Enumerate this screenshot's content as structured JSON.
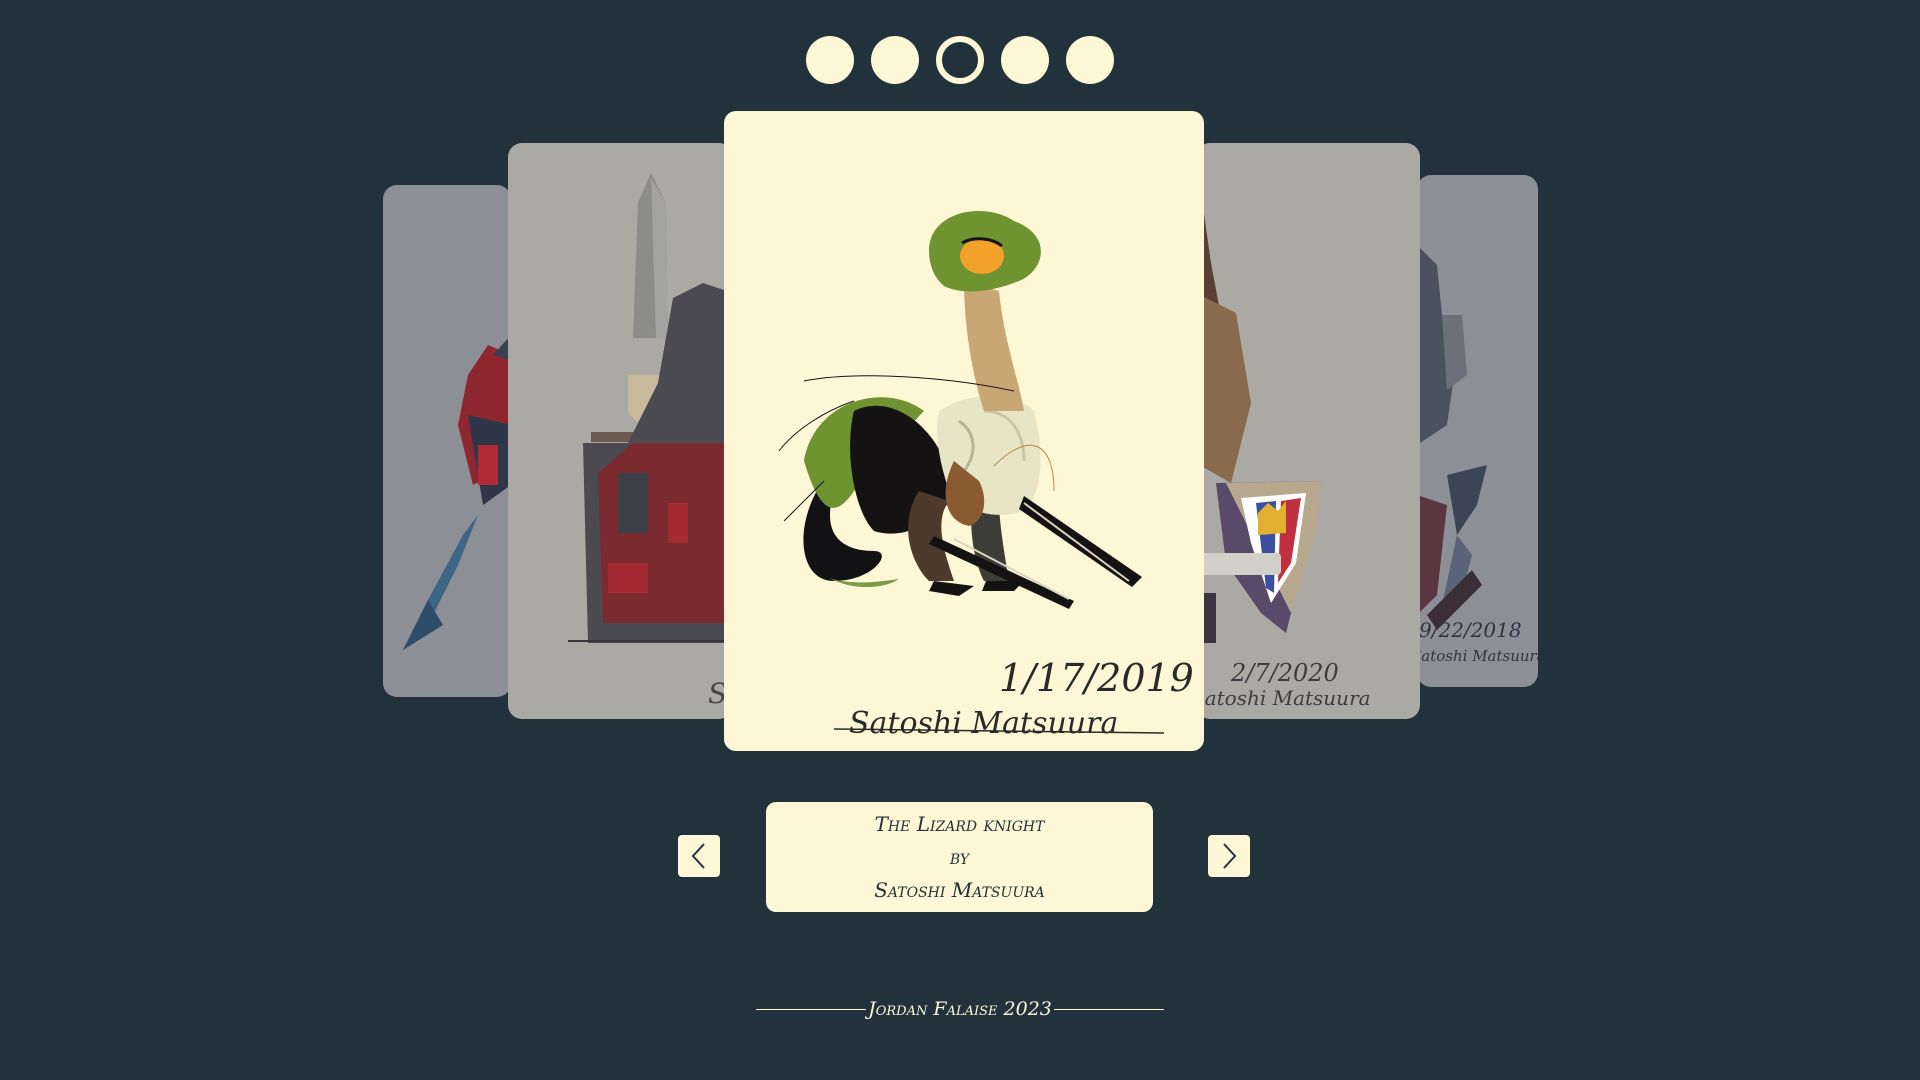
{
  "pagination": {
    "count": 5,
    "active_index": 2
  },
  "slides": [
    {
      "position": "far-left",
      "signature_date": "",
      "signature_name": ""
    },
    {
      "position": "left",
      "signature_date": "",
      "signature_name": "S"
    },
    {
      "position": "center",
      "signature_date": "1/17/2019",
      "signature_name": "Satoshi Matsuura"
    },
    {
      "position": "right",
      "signature_date": "2/7/2020",
      "signature_name": "Satoshi Matsuura"
    },
    {
      "position": "far-right",
      "signature_date": "9/22/2018",
      "signature_name": "Satoshi Matsuura"
    }
  ],
  "caption": {
    "title": "The Lizard knight",
    "by": "by",
    "artist": "Satoshi Matsuura"
  },
  "navigation": {
    "prev_icon": "chevron-left-icon",
    "next_icon": "chevron-right-icon"
  },
  "footer": {
    "text": "Jordan Falaise 2023"
  },
  "colors": {
    "background": "#22323c",
    "cream": "#fdf7d5",
    "side_card": "#aaa9a3",
    "far_card": "#8d8f97"
  }
}
